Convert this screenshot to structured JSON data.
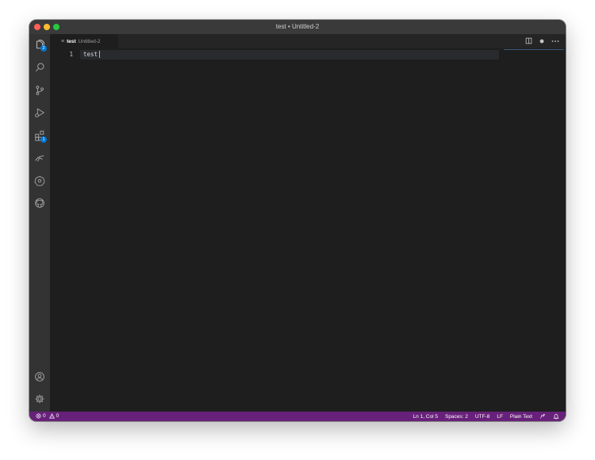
{
  "window": {
    "title": "test • Untitled-2"
  },
  "activity_bar": {
    "items": [
      {
        "name": "explorer",
        "icon": "files-icon",
        "badge": "2"
      },
      {
        "name": "search",
        "icon": "search-icon"
      },
      {
        "name": "source-control",
        "icon": "source-control-icon"
      },
      {
        "name": "run-and-debug",
        "icon": "run-debug-icon"
      },
      {
        "name": "extensions",
        "icon": "extensions-icon",
        "badge": "1"
      },
      {
        "name": "remote",
        "icon": "remote-icon"
      },
      {
        "name": "kubernetes",
        "icon": "kubernetes-icon"
      },
      {
        "name": "github",
        "icon": "github-icon"
      }
    ],
    "bottom_items": [
      {
        "name": "accounts",
        "icon": "account-icon"
      },
      {
        "name": "manage",
        "icon": "gear-icon"
      }
    ]
  },
  "tabs": [
    {
      "label": "test",
      "description": "Untitled-2",
      "icon": "text-file-icon",
      "active": true
    }
  ],
  "tab_actions": {
    "split": "split-editor-icon",
    "dirty": "unsaved-dot-icon",
    "more": "more-actions-icon"
  },
  "editor": {
    "lines": [
      {
        "number": "1",
        "text": "test"
      }
    ]
  },
  "status_bar": {
    "errors": "0",
    "warnings": "0",
    "position": "Ln 1, Col 5",
    "spaces": "Spaces: 2",
    "encoding": "UTF-8",
    "eol": "LF",
    "language": "Plain Text"
  },
  "colors": {
    "status_bar": "#68217a",
    "badge": "#0078d4",
    "editor_bg": "#1e1e1e",
    "activity_bar": "#333333"
  }
}
